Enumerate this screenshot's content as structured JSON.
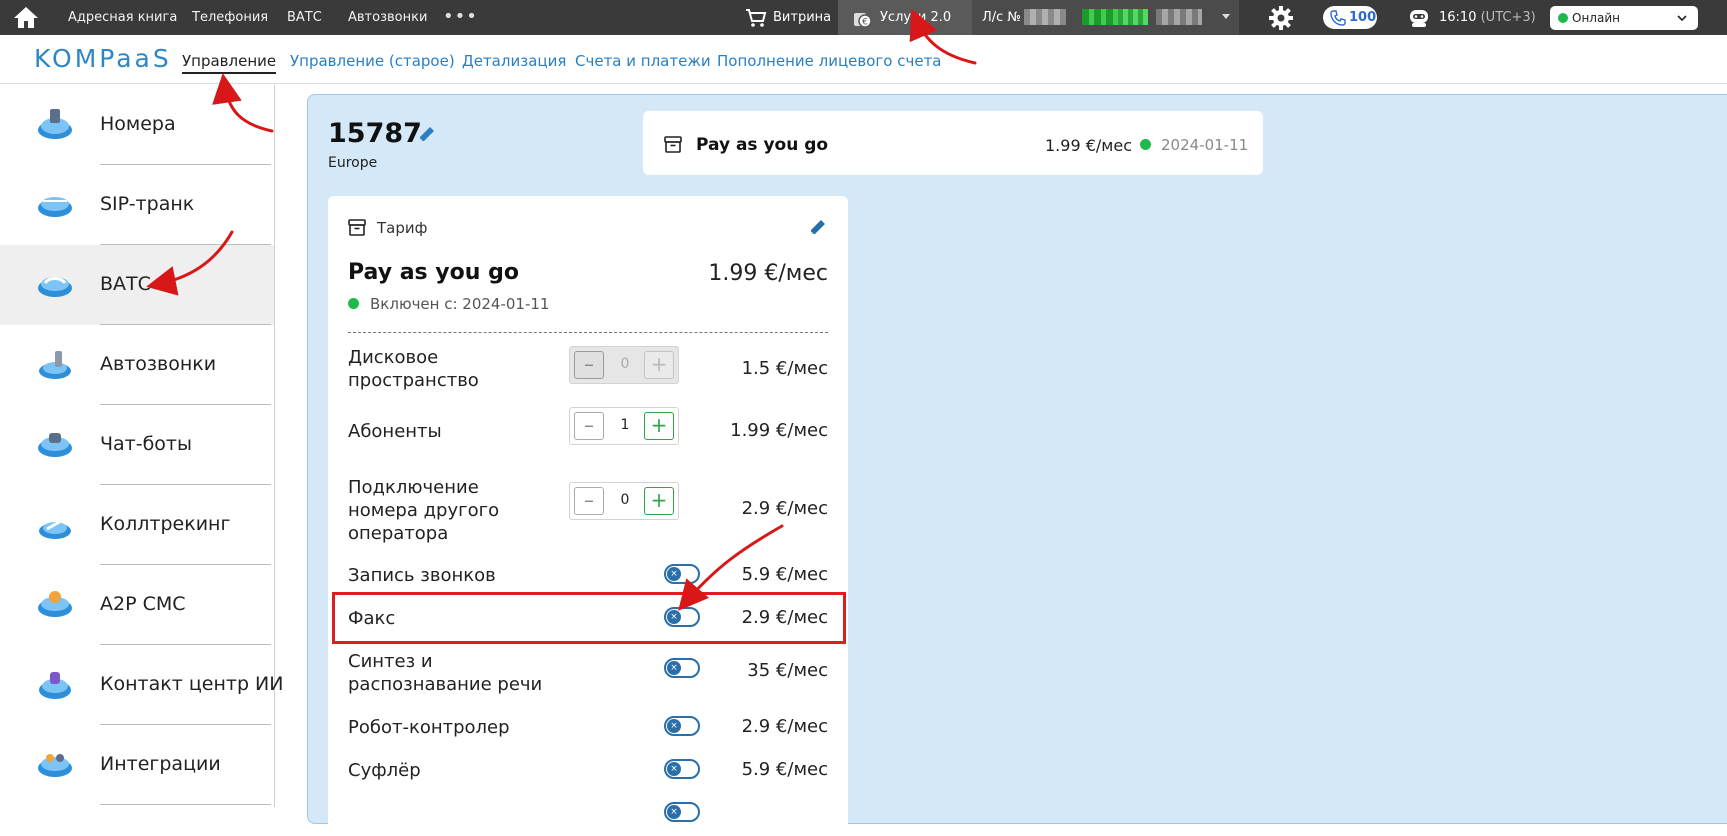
{
  "topbar": {
    "nav": [
      "Адресная книга",
      "Телефония",
      "ВАТС",
      "Автозвонки"
    ],
    "more": "•••",
    "storefront": "Витрина",
    "services": "Услуги 2.0",
    "account_label": "Л/с №",
    "calls_count": "100",
    "time": "16:10",
    "timezone": "(UTC+3)",
    "status": "Онлайн",
    "colors": {
      "bar": "#3a3a3a",
      "online": "#1fb84a"
    }
  },
  "subnav": {
    "logo": "KOMPaaS",
    "links": [
      "Управление",
      "Управление (старое)",
      "Детализация",
      "Счета и платежи",
      "Пополнение лицевого счета"
    ],
    "active": "Управление"
  },
  "sidebar": {
    "items": [
      {
        "label": "Номера",
        "icon": "numbers-cloud-icon"
      },
      {
        "label": "SIP-транк",
        "icon": "sip-cloud-icon"
      },
      {
        "label": "ВАТС",
        "icon": "pbx-cloud-icon",
        "active": true
      },
      {
        "label": "Автозвонки",
        "icon": "autocall-cloud-icon"
      },
      {
        "label": "Чат-боты",
        "icon": "chatbot-cloud-icon"
      },
      {
        "label": "Коллтрекинг",
        "icon": "calltracking-cloud-icon"
      },
      {
        "label": "A2P СМС",
        "icon": "sms-cloud-icon"
      },
      {
        "label": "Контакт центр ИИ",
        "icon": "ai-contact-center-cloud-icon"
      },
      {
        "label": "Интеграции",
        "icon": "integrations-cloud-icon"
      }
    ]
  },
  "main": {
    "account_id": "15787",
    "region": "Europe",
    "plan_card": {
      "name": "Pay as you go",
      "price": "1.99 €/мес",
      "date": "2024-01-11"
    },
    "tariff": {
      "header": "Тариф",
      "plan_name": "Pay as you go",
      "plan_price": "1.99 €/мес",
      "enabled_since": "Включен с: 2024-01-11",
      "options": [
        {
          "label": "Дисковое пространство",
          "control": "stepper",
          "value": "0",
          "disabled": true,
          "price": "1.5 €/мес"
        },
        {
          "label": "Абоненты",
          "control": "stepper",
          "value": "1",
          "price": "1.99 €/мес"
        },
        {
          "label": "Подключение номера другого оператора",
          "control": "stepper",
          "value": "0",
          "price": "2.9 €/мес"
        },
        {
          "label": "Запись звонков",
          "control": "toggle",
          "on": false,
          "price": "5.9 €/мес"
        },
        {
          "label": "Факс",
          "control": "toggle",
          "on": false,
          "price": "2.9 €/мес",
          "highlighted": true
        },
        {
          "label": "Синтез и распознавание речи",
          "control": "toggle",
          "on": false,
          "price": "35 €/мес"
        },
        {
          "label": "Робот-контролер",
          "control": "toggle",
          "on": false,
          "price": "2.9 €/мес"
        },
        {
          "label": "Суфлёр",
          "control": "toggle",
          "on": false,
          "price": "5.9 €/мес"
        }
      ]
    },
    "colors": {
      "panel": "#d4e8f7",
      "accent": "#2a6fa9",
      "highlight": "#d82020"
    }
  }
}
